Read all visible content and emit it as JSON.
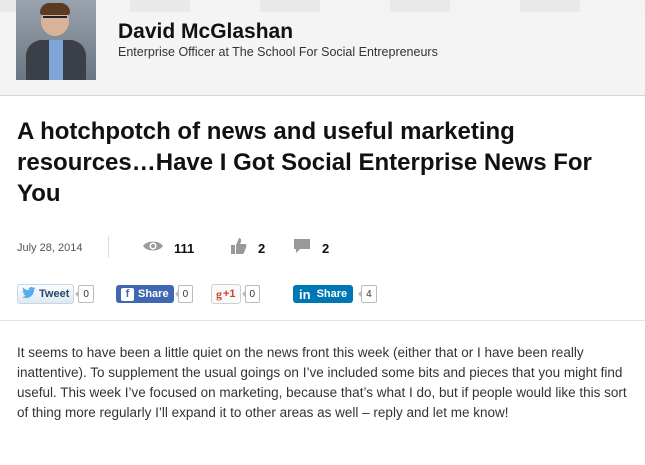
{
  "author": {
    "name": "David McGlashan",
    "title": "Enterprise Officer at The School For Social Entrepreneurs"
  },
  "post": {
    "title": "A hotchpotch of news and useful marketing resources…Have I Got Social Enterprise News For You",
    "date": "July 28, 2014",
    "views": "111",
    "likes": "2",
    "comments": "2",
    "body": "It seems to have been a little quiet on the news front this week (either that or I have been really inattentive). To supplement the usual goings on I’ve included some bits and pieces that you might find useful. This week I’ve focused on marketing, because that’s what I do, but if people would like this sort of thing more regularly I’ll expand it to other areas as well – reply and let me know!"
  },
  "share": {
    "tweet_label": "Tweet",
    "tweet_count": "0",
    "facebook_label": "Share",
    "facebook_count": "0",
    "gplus_label": "+1",
    "gplus_count": "0",
    "linkedin_label": "Share",
    "linkedin_count": "4"
  },
  "icons": {
    "views": "eye-icon",
    "likes": "thumbs-up-icon",
    "comments": "comment-icon",
    "twitter": "twitter-bird-icon",
    "facebook": "facebook-f-icon",
    "gplus": "google-plus-icon",
    "linkedin": "linkedin-in-icon"
  },
  "colors": {
    "facebook": "#4267b2",
    "linkedin": "#0077b5",
    "gplus": "#d0422e",
    "twitter": "#55acee"
  }
}
